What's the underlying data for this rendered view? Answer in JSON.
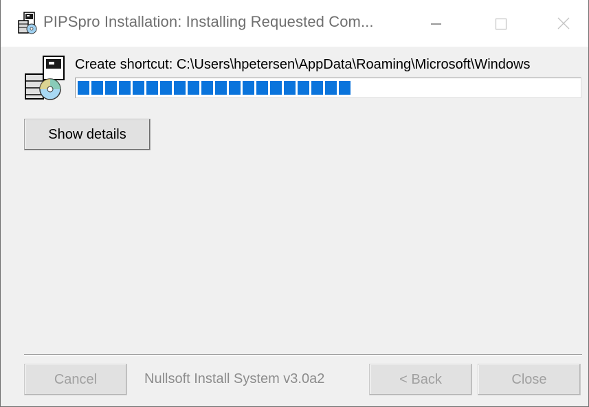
{
  "window": {
    "title": "PIPSpro Installation: Installing Requested Com...",
    "icons": {
      "app": "installer-icon",
      "minimize": "minimize-icon",
      "maximize": "maximize-icon",
      "close": "close-icon"
    }
  },
  "status": {
    "text": "Create shortcut: C:\\Users\\hpetersen\\AppData\\Roaming\\Microsoft\\Windows",
    "icon": "installer-cd-icon",
    "progress_fraction": 0.55
  },
  "buttons": {
    "show_details": "Show details",
    "cancel": "Cancel",
    "back": "< Back",
    "close": "Close"
  },
  "branding": "Nullsoft Install System v3.0a2",
  "colors": {
    "progress": "#0a74dc",
    "background": "#f0f0f0",
    "titlebar": "#ffffff"
  }
}
